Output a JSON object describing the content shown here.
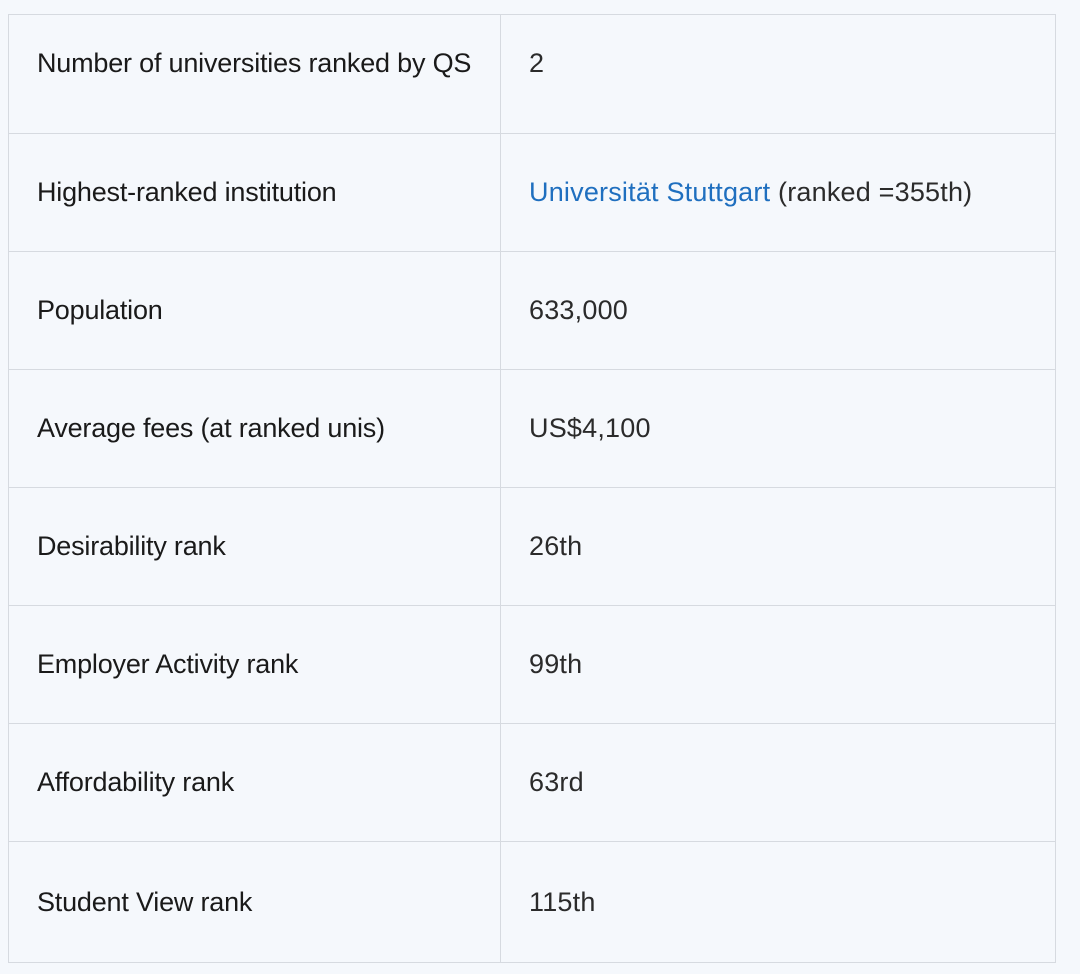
{
  "table": {
    "rows": [
      {
        "label": "Number of universities ranked by QS",
        "value": "2"
      },
      {
        "label": "Highest-ranked institution",
        "link_text": "Universität Stuttgart",
        "value_suffix": " (ranked =355th)"
      },
      {
        "label": "Population",
        "value": "633,000"
      },
      {
        "label": "Average fees (at ranked unis)",
        "value": "US$4,100"
      },
      {
        "label": "Desirability rank",
        "value": "26th"
      },
      {
        "label": "Employer Activity rank",
        "value": "99th"
      },
      {
        "label": "Affordability rank",
        "value": "63rd"
      },
      {
        "label": "Student View rank",
        "value": "115th"
      }
    ]
  },
  "colors": {
    "background": "#f5f8fc",
    "border": "#d6dae0",
    "link": "#1f6fbf",
    "text": "#1a1a1a"
  }
}
